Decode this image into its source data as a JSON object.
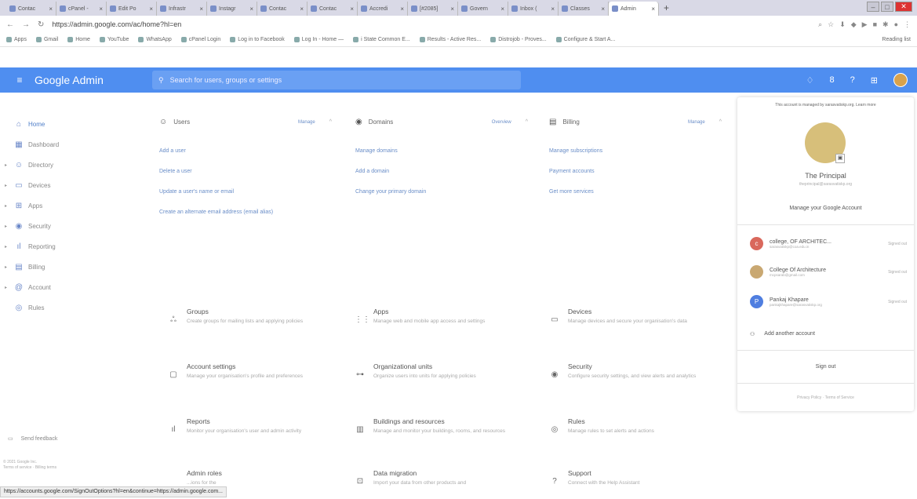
{
  "browser": {
    "tabs": [
      {
        "label": "Contac"
      },
      {
        "label": "cPanel -"
      },
      {
        "label": "Edit Po"
      },
      {
        "label": "Infrastr"
      },
      {
        "label": "Instagr"
      },
      {
        "label": "Contac"
      },
      {
        "label": "Contac"
      },
      {
        "label": "Accredi"
      },
      {
        "label": "[#2085]"
      },
      {
        "label": "Govern"
      },
      {
        "label": "Inbox ("
      },
      {
        "label": "Classes"
      },
      {
        "label": "Admin"
      }
    ],
    "url": "https://admin.google.com/ac/home?hl=en",
    "bookmarks": [
      "Apps",
      "Gmail",
      "Home",
      "YouTube",
      "WhatsApp",
      "cPanel Login",
      "Log in to Facebook",
      "Log In - Home —",
      "i State Common E...",
      "Results - Active Res...",
      "Distrojob - Proves...",
      "Configure & Start A..."
    ],
    "reading_list": "Reading list",
    "status_url": "https://accounts.google.com/SignOutOptions?hl=en&continue=https://admin.google.com..."
  },
  "header": {
    "brand": "Google Admin",
    "search_placeholder": "Search for users, groups or settings"
  },
  "sidebar": {
    "items": [
      {
        "label": "Home",
        "icon": "home-icon",
        "glyph": "⌂"
      },
      {
        "label": "Dashboard",
        "icon": "dashboard-icon",
        "glyph": "▦"
      },
      {
        "label": "Directory",
        "icon": "people-icon",
        "glyph": "☺"
      },
      {
        "label": "Devices",
        "icon": "devices-icon",
        "glyph": "▭"
      },
      {
        "label": "Apps",
        "icon": "apps-grid-icon",
        "glyph": "⊞"
      },
      {
        "label": "Security",
        "icon": "shield-icon",
        "glyph": "◉"
      },
      {
        "label": "Reporting",
        "icon": "bar-chart-icon",
        "glyph": "ıl"
      },
      {
        "label": "Billing",
        "icon": "credit-card-icon",
        "glyph": "▤"
      },
      {
        "label": "Account",
        "icon": "at-sign-icon",
        "glyph": "@"
      },
      {
        "label": "Rules",
        "icon": "rules-icon",
        "glyph": "◎"
      }
    ],
    "feedback": "Send feedback",
    "footer_1": "© 2021 Google Inc.",
    "footer_2": "Terms of service · Billing terms"
  },
  "cards": [
    {
      "title": "Users",
      "action": "Manage",
      "links": [
        "Add a user",
        "Delete a user",
        "Update a user's name or email",
        "Create an alternate email address (email alias)"
      ]
    },
    {
      "title": "Domains",
      "action": "Overview",
      "links": [
        "Manage domains",
        "Add a domain",
        "Change your primary domain"
      ]
    },
    {
      "title": "Billing",
      "action": "Manage",
      "links": [
        "Manage subscriptions",
        "Payment accounts",
        "Get more services"
      ]
    }
  ],
  "tiles": [
    {
      "title": "Groups",
      "desc": "Create groups for mailing lists and applying policies",
      "glyph": "ஃ"
    },
    {
      "title": "Apps",
      "desc": "Manage web and mobile app access and settings",
      "glyph": "⋮⋮"
    },
    {
      "title": "Devices",
      "desc": "Manage devices and secure your organisation's data",
      "glyph": "▭"
    },
    {
      "title": "Account settings",
      "desc": "Manage your organisation's profile and preferences",
      "glyph": "▢"
    },
    {
      "title": "Organizational units",
      "desc": "Organize users into units for applying policies",
      "glyph": "⊶"
    },
    {
      "title": "Security",
      "desc": "Configure security settings, and view alerts and analytics",
      "glyph": "◉"
    },
    {
      "title": "Reports",
      "desc": "Monitor your organisation's user and admin activity",
      "glyph": "ıl"
    },
    {
      "title": "Buildings and resources",
      "desc": "Manage and monitor your buildings, rooms, and resources",
      "glyph": "▥"
    },
    {
      "title": "Rules",
      "desc": "Manage rules to set alerts and actions",
      "glyph": "◎"
    },
    {
      "title": "Admin roles",
      "desc": "...ions for the",
      "glyph": ""
    },
    {
      "title": "Data migration",
      "desc": "Import your data from other products and",
      "glyph": "⊡"
    },
    {
      "title": "Support",
      "desc": "Connect with the Help Assistant",
      "glyph": "?"
    }
  ],
  "account_panel": {
    "notice": "This account is managed by sarasvatiskp.org. Learn more",
    "name": "The Principal",
    "email": "theprincipal@sarasvatiskp.org",
    "manage": "Manage your Google Account",
    "accounts": [
      {
        "name": "college, OF ARCHITEC...",
        "email": "sarasvatiskp@coa.edu.in",
        "status": "Signed out",
        "initial": "c",
        "color": "#d9685c"
      },
      {
        "name": "College Of Architecture",
        "email": "mcpsarab@gmail.com",
        "status": "Signed out",
        "initial": "",
        "color": "#c9a872"
      },
      {
        "name": "Pankaj Khapare",
        "email": "pankajkhapare@sarasvatiskp.org",
        "status": "Signed out",
        "initial": "P",
        "color": "#4f7ee0"
      }
    ],
    "add_another": "Add another account",
    "sign_out": "Sign out",
    "footer": "Privacy Policy  ·  Terms of Service"
  }
}
